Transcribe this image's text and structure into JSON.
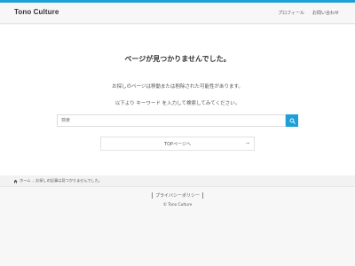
{
  "header": {
    "site_title": "Tono Culture",
    "nav": [
      "プロフィール",
      "お問い合わせ"
    ]
  },
  "main": {
    "heading": "ページが見つかりませんでした。",
    "message1": "お探しのページは移動または削除された可能性があります。",
    "message2": "以下より キーワード を入力して検索してみてください。",
    "search": {
      "placeholder": "検索",
      "value": ""
    },
    "top_link": {
      "label": "TOPページへ",
      "arrow": "→"
    }
  },
  "breadcrumb": {
    "home": "ホーム",
    "current": "お探しの記事は見つかりませんでした。"
  },
  "footer": {
    "privacy": "プライバシーポリシー",
    "copyright": "© Tono Culture"
  },
  "colors": {
    "accent": "#1e9fd6",
    "background": "#f7f7f7",
    "content_background": "#ffffff"
  },
  "icons": [
    "search-icon",
    "home-icon",
    "chevron-right-icon"
  ]
}
